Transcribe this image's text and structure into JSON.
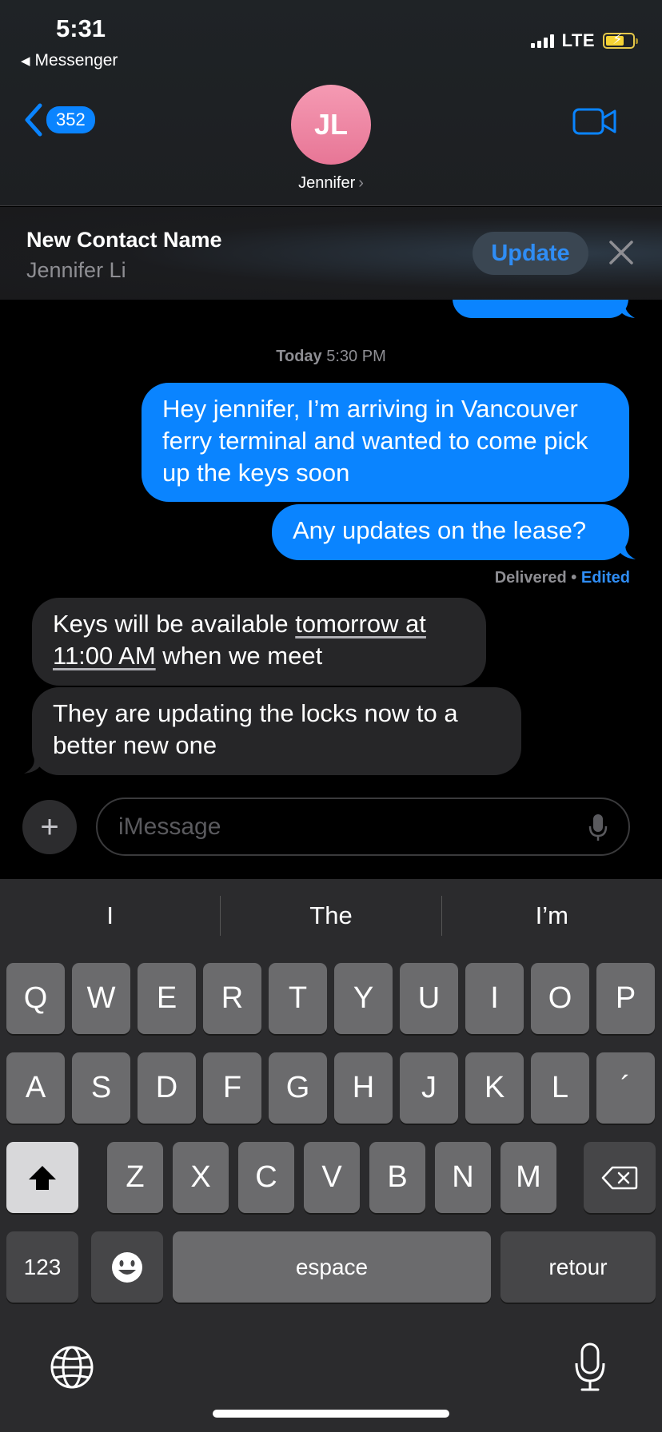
{
  "status_bar": {
    "time": "5:31",
    "back_app": "Messenger",
    "network": "LTE"
  },
  "header": {
    "back_badge": "352",
    "avatar_initials": "JL",
    "contact_name": "Jennifer",
    "accent_color": "#0a84ff",
    "avatar_color": "#ee86a3"
  },
  "banner": {
    "title": "New Contact Name",
    "subtitle": "Jennifer Li",
    "update_label": "Update"
  },
  "conversation": {
    "timestamp_day": "Today",
    "timestamp_time": "5:30 PM",
    "messages": [
      {
        "direction": "outgoing",
        "text": "Hey jennifer, I’m arriving in Vancouver ferry terminal and wanted to come pick up the keys soon"
      },
      {
        "direction": "outgoing",
        "text": "Any updates on the lease?"
      },
      {
        "direction": "incoming",
        "text_before": "Keys will be available ",
        "link_text": "tomorrow at 11:00 AM",
        "text_after": " when we meet"
      },
      {
        "direction": "incoming",
        "text": "They are updating the locks now to a better new one"
      }
    ],
    "delivery_status": "Delivered",
    "edited_label": "Edited"
  },
  "composer": {
    "placeholder": "iMessage"
  },
  "keyboard": {
    "suggestions": [
      "I",
      "The",
      "I’m"
    ],
    "row1": [
      "Q",
      "W",
      "E",
      "R",
      "T",
      "Y",
      "U",
      "I",
      "O",
      "P"
    ],
    "row2": [
      "A",
      "S",
      "D",
      "F",
      "G",
      "H",
      "J",
      "K",
      "L",
      "´"
    ],
    "row3": [
      "Z",
      "X",
      "C",
      "V",
      "B",
      "N",
      "M"
    ],
    "numbers_label": "123",
    "space_label": "espace",
    "return_label": "retour"
  }
}
